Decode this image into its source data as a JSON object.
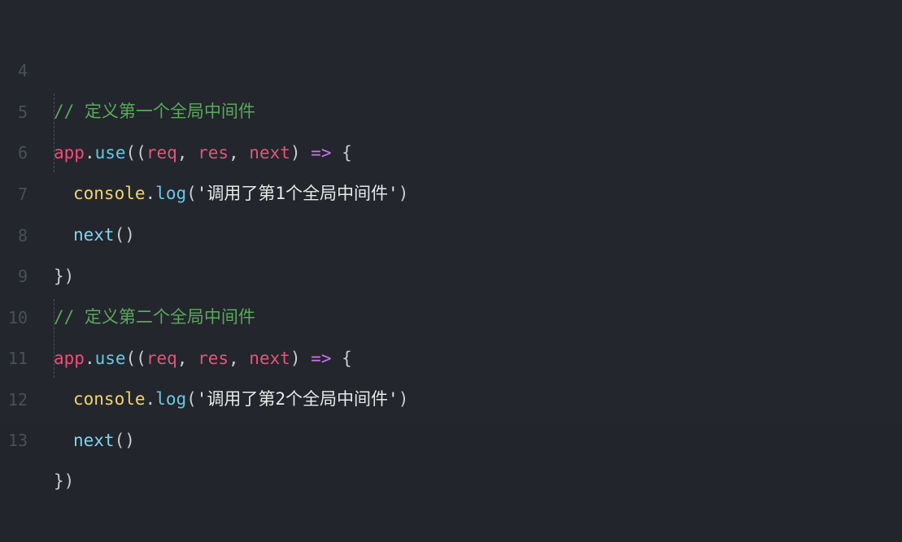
{
  "editor": {
    "lines": [
      {
        "n": "4",
        "comment": "// 定义第一个全局中间件"
      },
      {
        "n": "5",
        "obj": "app",
        "method": "use",
        "params": [
          "req",
          "res",
          "next"
        ],
        "arrow": "=>",
        "open": "{"
      },
      {
        "n": "6",
        "console": "console",
        "log": "log",
        "string": "'调用了第1个全局中间件'"
      },
      {
        "n": "7",
        "call": "next",
        "call_parens": "()"
      },
      {
        "n": "8",
        "close": "})"
      },
      {
        "n": "9",
        "comment": "// 定义第二个全局中间件"
      },
      {
        "n": "10",
        "obj": "app",
        "method": "use",
        "params": [
          "req",
          "res",
          "next"
        ],
        "arrow": "=>",
        "open": "{"
      },
      {
        "n": "11",
        "console": "console",
        "log": "log",
        "string": "'调用了第2个全局中间件'"
      },
      {
        "n": "12",
        "call": "next",
        "call_parens": "()"
      },
      {
        "n": "13",
        "close": "})"
      }
    ]
  },
  "colors": {
    "background": "#23262c",
    "comment": "#59a95c",
    "identifier": "#f24c7a",
    "method": "#67c8e6",
    "param": "#e2557b",
    "arrow": "#c874ec",
    "console": "#f0d36f"
  }
}
